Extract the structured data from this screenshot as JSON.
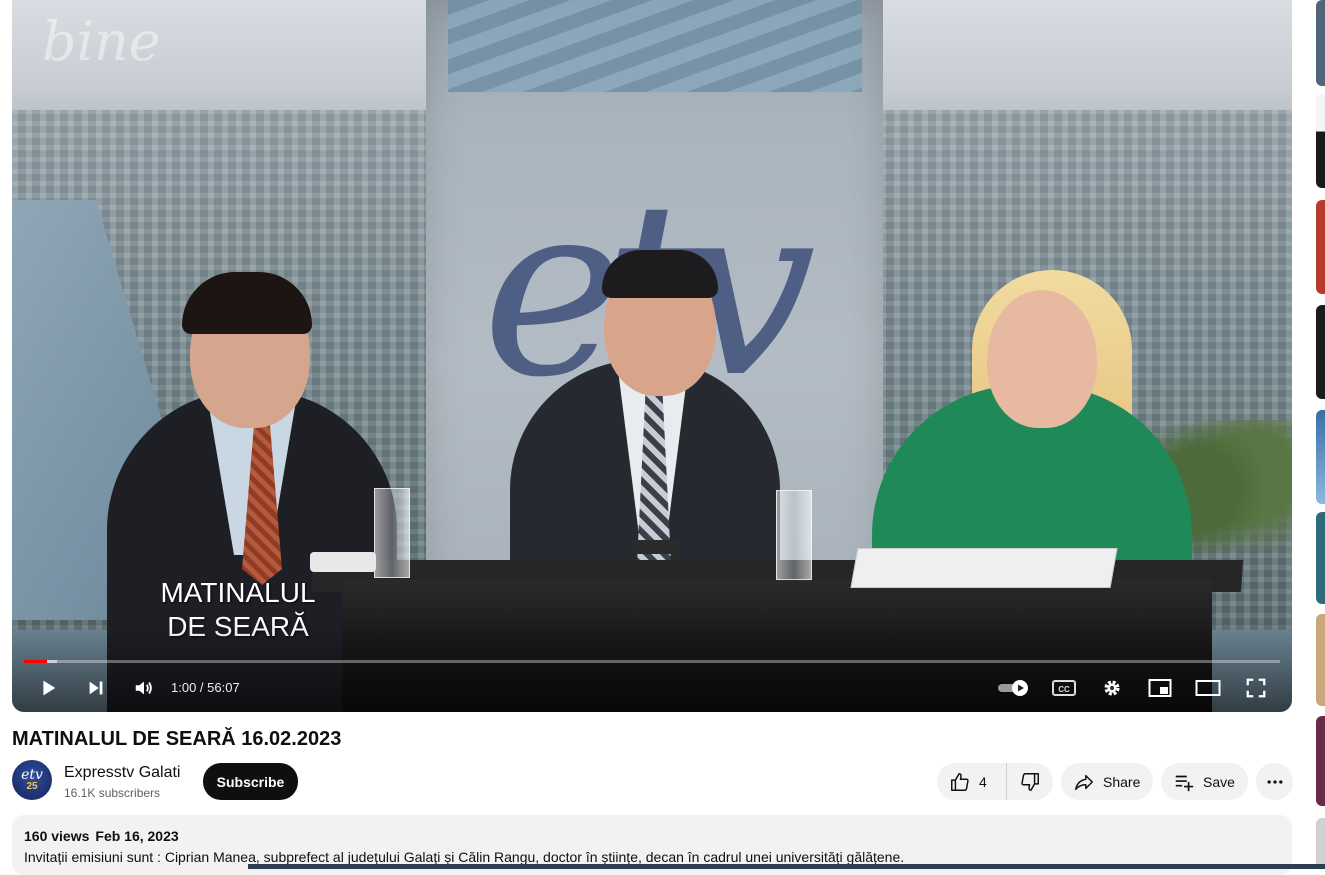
{
  "player": {
    "show_caption_line1": "MATINALUL",
    "show_caption_line2": "DE SEARĂ",
    "watermark_logo": "etv",
    "top_logo": "bine",
    "time_display": "1:00 / 56:07",
    "progress_percent": 1.8,
    "buffer_percent": 2.6,
    "controls": [
      "play-icon",
      "next-icon",
      "volume-icon",
      "autoplay-toggle",
      "captions-icon",
      "settings-icon",
      "miniplayer-icon",
      "theater-icon",
      "fullscreen-icon"
    ],
    "captions_label": "CC"
  },
  "video": {
    "title": "MATINALUL DE SEARĂ 16.02.2023"
  },
  "channel": {
    "name": "Expresstv Galati",
    "subscribers": "16.1K subscribers",
    "avatar_text": "etv",
    "avatar_badge": "25",
    "subscribe_label": "Subscribe"
  },
  "actions": {
    "like_count": "4",
    "share_label": "Share",
    "save_label": "Save"
  },
  "description": {
    "views": "160 views",
    "date": "Feb 16, 2023",
    "text": "Invitații emisiuni sunt : Ciprian Manea, subprefect al județului Galați și Călin Rangu, doctor în științe, decan în cadrul unei universități gălățene."
  },
  "colors": {
    "accent_red": "#ff0000",
    "subscribe_bg": "#0f0f0f",
    "pill_bg": "#f2f2f2",
    "studio_green": "#1f8a57"
  }
}
